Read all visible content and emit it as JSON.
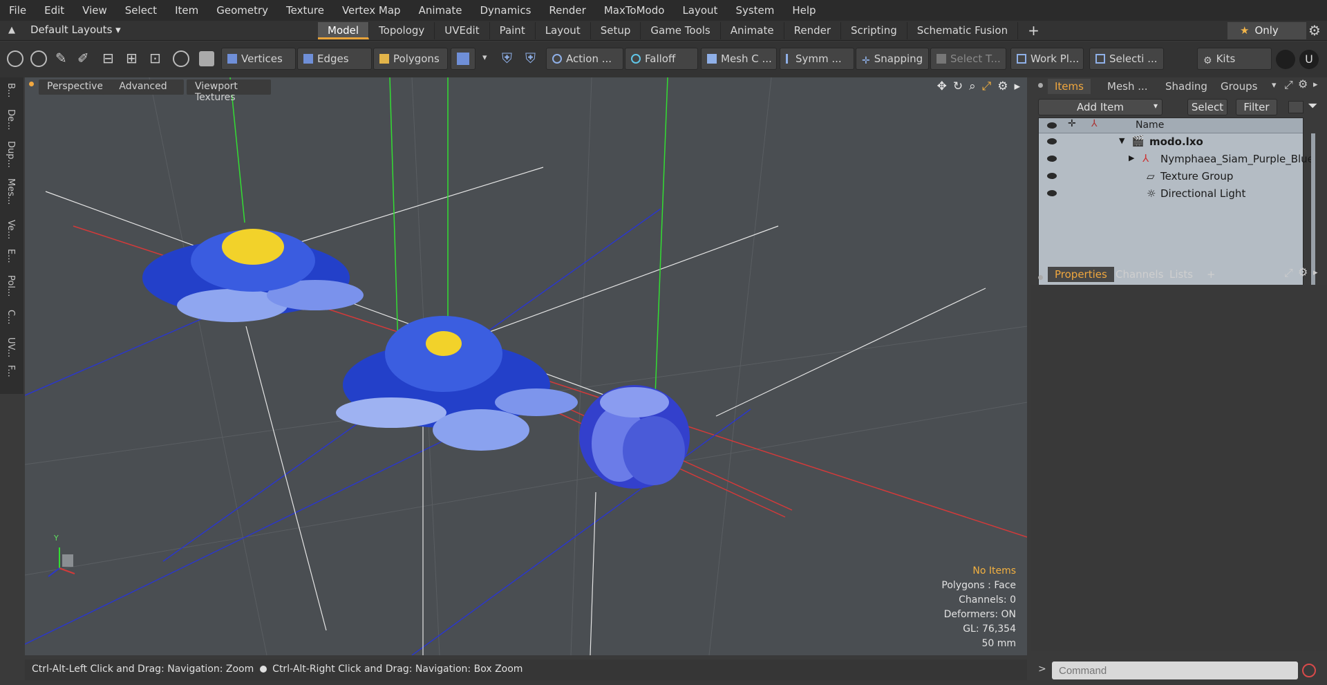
{
  "menu": [
    "File",
    "Edit",
    "View",
    "Select",
    "Item",
    "Geometry",
    "Texture",
    "Vertex Map",
    "Animate",
    "Dynamics",
    "Render",
    "MaxToModo",
    "Layout",
    "System",
    "Help"
  ],
  "layout_dropdown": "Default Layouts",
  "tabs": [
    "Model",
    "Topology",
    "UVEdit",
    "Paint",
    "Layout",
    "Setup",
    "Game Tools",
    "Animate",
    "Render",
    "Scripting",
    "Schematic Fusion"
  ],
  "active_tab": "Model",
  "add_tab_symbol": "+",
  "only_label": "Only",
  "toolbar": {
    "vertices": "Vertices",
    "edges": "Edges",
    "polygons": "Polygons",
    "action": "Action",
    "falloff": "Falloff",
    "mesh_constraint": "Mesh C ...",
    "symmetry": "Symm ...",
    "snapping": "Snapping",
    "select_through": "Select T...",
    "work_plane": "Work Pl...",
    "selection_sets": "Selecti ...",
    "kits": "Kits"
  },
  "left_tabs": [
    "B...",
    "De...",
    "Dup...",
    "Mes...",
    "Ve...",
    "E...",
    "Pol...",
    "C...",
    "UV...",
    "F..."
  ],
  "viewport": {
    "perspective": "Perspective",
    "advanced": "Advanced",
    "viewport_textures": "Viewport Textures",
    "info": {
      "no_items": "No Items",
      "polygons": "Polygons : Face",
      "channels": "Channels: 0",
      "deformers": "Deformers: ON",
      "gl": "GL: 76,354",
      "focal": "50 mm"
    },
    "axis_y": "Y"
  },
  "status": {
    "left_hint": "Ctrl-Alt-Left Click and Drag: Navigation: Zoom",
    "right_hint": "Ctrl-Alt-Right Click and Drag: Navigation: Box Zoom"
  },
  "items_panel": {
    "tabs": [
      "Items",
      "Mesh ...",
      "Shading",
      "Groups"
    ],
    "active_tab": "Items",
    "add_item": "Add Item",
    "select": "Select",
    "filter": "Filter",
    "name_header": "Name",
    "tree": [
      {
        "label": "modo.lxo",
        "bold": true
      },
      {
        "label": "Nymphaea_Siam_Purple_Blue"
      },
      {
        "label": "Texture Group"
      },
      {
        "label": "Directional Light"
      }
    ]
  },
  "properties_panel": {
    "tabs": [
      "Properties",
      "Channels",
      "Lists"
    ],
    "active_tab": "Properties",
    "add_symbol": "+"
  },
  "command_placeholder": "Command",
  "colors": {
    "accent": "#e8a33a",
    "viewport_bg": "#4a4e52",
    "grid_red": "#d33a3a",
    "grid_blue": "#2b37c9",
    "grid_green": "#33dd33",
    "flower_blue": "#2f4fd8"
  }
}
